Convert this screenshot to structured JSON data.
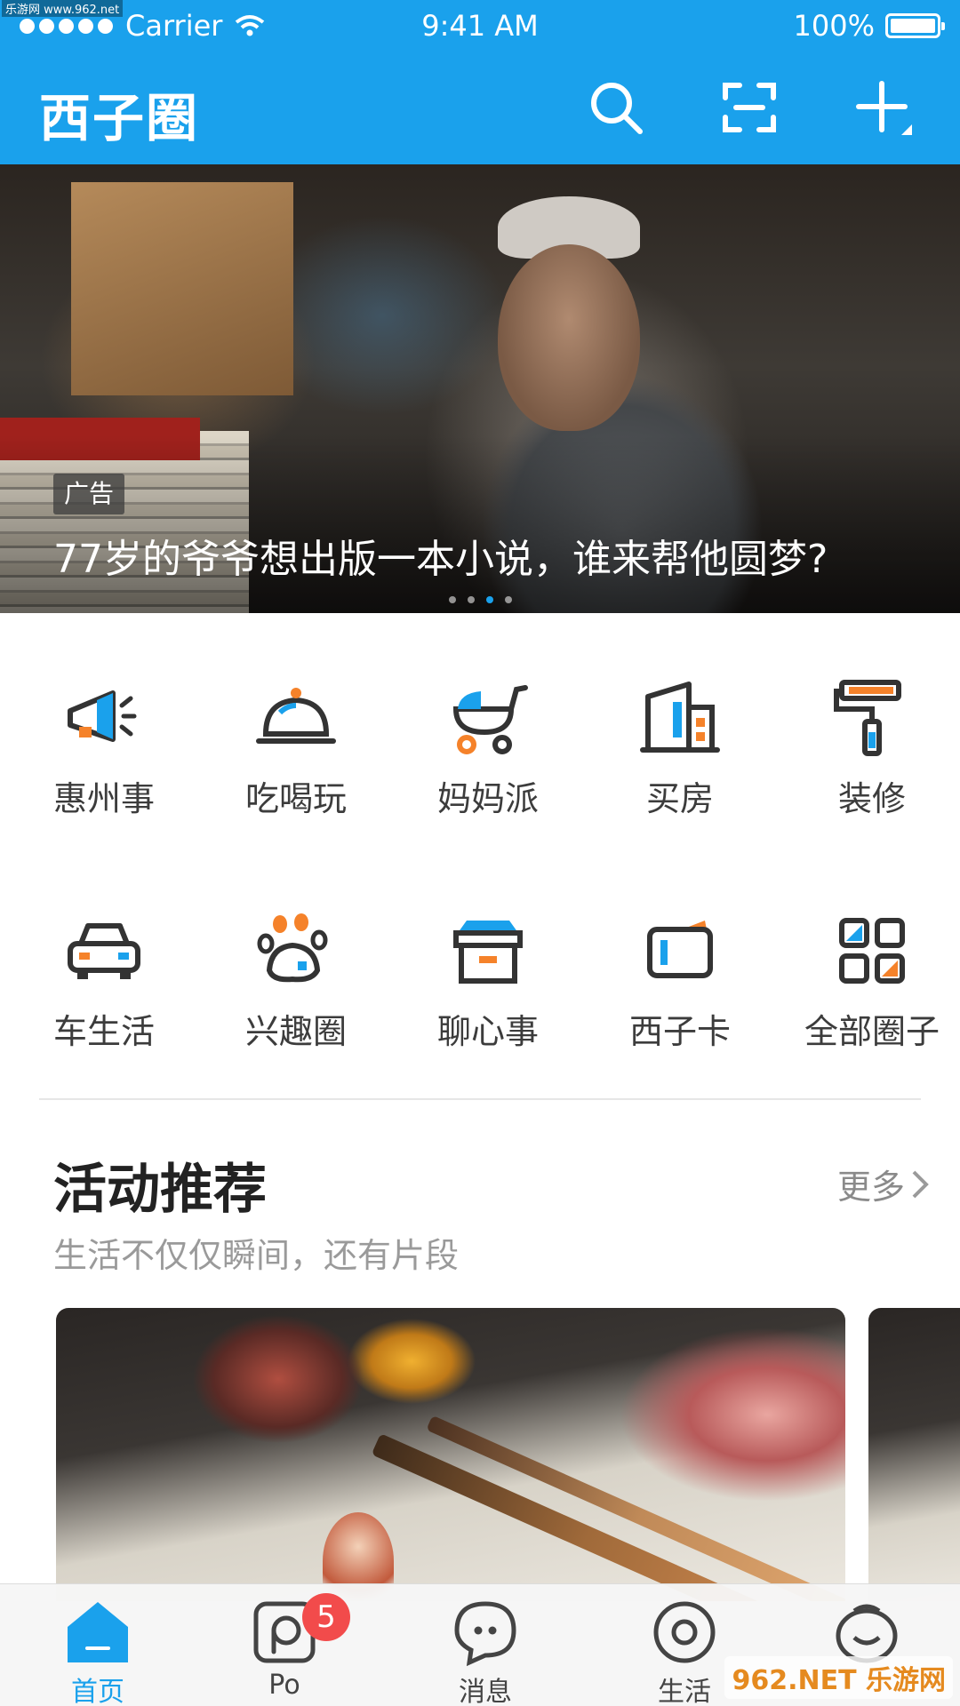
{
  "status_bar": {
    "carrier": "Carrier",
    "time": "9:41 AM",
    "battery": "100%"
  },
  "watermark_top": "乐游网 www.962.net",
  "header": {
    "logo": "西子圈"
  },
  "banner": {
    "tag": "广告",
    "title": "77岁的爷爷想出版一本小说，谁来帮他圆梦?",
    "page_count": 4,
    "active_page": 3
  },
  "categories": [
    {
      "label": "惠州事",
      "icon": "megaphone-icon"
    },
    {
      "label": "吃喝玩",
      "icon": "food-cloche-icon"
    },
    {
      "label": "妈妈派",
      "icon": "stroller-icon"
    },
    {
      "label": "买房",
      "icon": "building-icon"
    },
    {
      "label": "装修",
      "icon": "paint-roller-icon"
    },
    {
      "label": "车生活",
      "icon": "car-icon"
    },
    {
      "label": "兴趣圈",
      "icon": "paw-icon"
    },
    {
      "label": "聊心事",
      "icon": "gift-box-icon"
    },
    {
      "label": "西子卡",
      "icon": "card-icon"
    },
    {
      "label": "全部圈子",
      "icon": "grid-icon"
    }
  ],
  "activity": {
    "title": "活动推荐",
    "more": "更多",
    "subtitle": "生活不仅仅瞬间，还有片段"
  },
  "tabs": [
    {
      "label": "首页",
      "icon": "home-icon",
      "active": true
    },
    {
      "label": "Po",
      "icon": "po-icon",
      "badge": "5"
    },
    {
      "label": "消息",
      "icon": "message-icon"
    },
    {
      "label": "生活",
      "icon": "life-icon"
    },
    {
      "label": "",
      "icon": "me-icon"
    }
  ],
  "watermark": "962.NET 乐游网",
  "colors": {
    "brand": "#1aa1ec",
    "accent_orange": "#f5822a",
    "badge": "#f24b4b"
  }
}
